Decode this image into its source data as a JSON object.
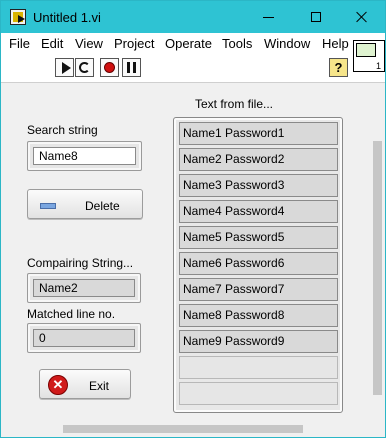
{
  "window": {
    "title": "Untitled 1.vi"
  },
  "menu": [
    "File",
    "Edit",
    "View",
    "Project",
    "Operate",
    "Tools",
    "Window",
    "Help"
  ],
  "toolbar": {
    "help_glyph": "?"
  },
  "vi_icon": {
    "number": "1"
  },
  "search": {
    "label": "Search string",
    "value": "Name8"
  },
  "delete_button": {
    "label": "Delete"
  },
  "comparing": {
    "label": "Compairing String...",
    "value": "Name2"
  },
  "matched": {
    "label": "Matched line no.",
    "value": "0"
  },
  "exit_button": {
    "label": "Exit",
    "glyph": "✕"
  },
  "file_list": {
    "label": "Text from file...",
    "rows": [
      "Name1 Password1",
      "Name2 Password2",
      "Name3 Password3",
      "Name4 Password4",
      "Name5 Password5",
      "Name6 Password6",
      "Name7 Password7",
      "Name8 Password8",
      "Name9 Password9",
      "",
      ""
    ]
  }
}
